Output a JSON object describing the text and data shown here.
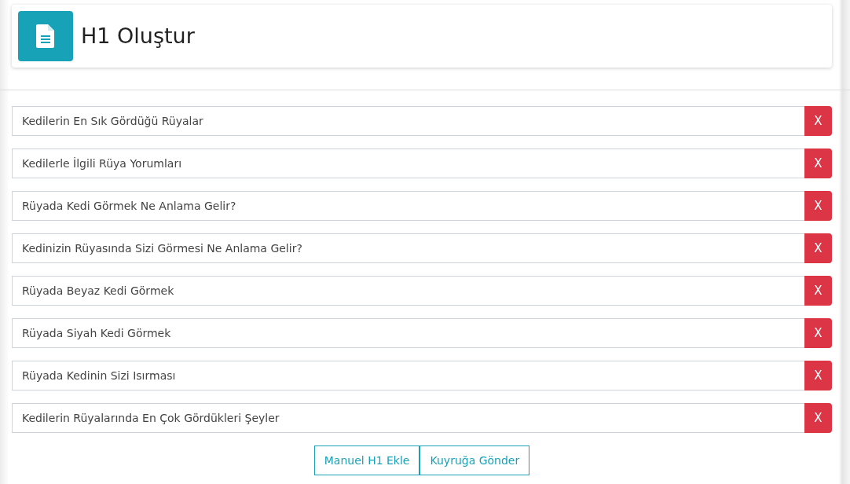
{
  "header": {
    "title": "H1 Oluştur"
  },
  "headings": [
    {
      "value": "Kedilerin En Sık Gördüğü Rüyalar",
      "remove": "X"
    },
    {
      "value": "Kedilerle İlgili Rüya Yorumları",
      "remove": "X"
    },
    {
      "value": "Rüyada Kedi Görmek Ne Anlama Gelir?",
      "remove": "X"
    },
    {
      "value": "Kedinizin Rüyasında Sizi Görmesi Ne Anlama Gelir?",
      "remove": "X"
    },
    {
      "value": "Rüyada Beyaz Kedi Görmek",
      "remove": "X"
    },
    {
      "value": "Rüyada Siyah Kedi Görmek",
      "remove": "X"
    },
    {
      "value": "Rüyada Kedinin Sizi Isırması",
      "remove": "X"
    },
    {
      "value": "Kedilerin Rüyalarında En Çok Gördükleri Şeyler",
      "remove": "X"
    }
  ],
  "buttons": [
    "Manuel H1 Ekle",
    "Kuyruğa Gönder"
  ]
}
